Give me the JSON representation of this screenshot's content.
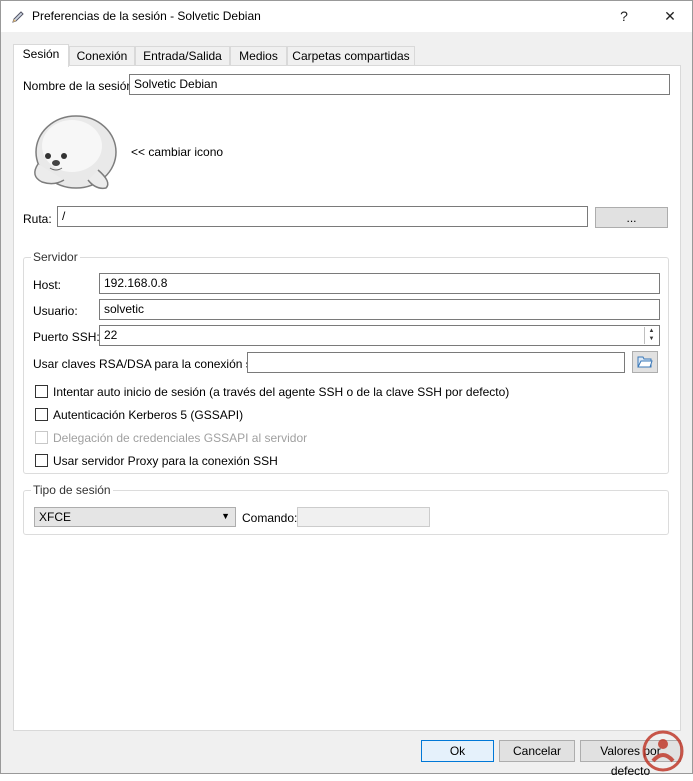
{
  "window": {
    "title": "Preferencias de la sesión - Solvetic Debian",
    "help_label": "?",
    "close_label": "✕"
  },
  "tabs": [
    {
      "label": "Sesión"
    },
    {
      "label": "Conexión"
    },
    {
      "label": "Entrada/Salida"
    },
    {
      "label": "Medios"
    },
    {
      "label": "Carpetas compartidas"
    }
  ],
  "session": {
    "name_label": "Nombre de la sesión:",
    "name_value": "Solvetic Debian",
    "change_icon_label": "<< cambiar icono",
    "path_label": "Ruta:",
    "path_value": "/",
    "browse_label": "..."
  },
  "server": {
    "group_title": "Servidor",
    "host_label": "Host:",
    "host_value": "192.168.0.8",
    "user_label": "Usuario:",
    "user_value": "solvetic",
    "port_label": "Puerto SSH:",
    "port_value": "22",
    "rsa_label": "Usar claves RSA/DSA para la conexión ssh:",
    "rsa_value": "",
    "checkboxes": [
      {
        "label": "Intentar auto inicio de sesión (a través del agente SSH o de la clave SSH por defecto)",
        "checked": false,
        "enabled": true
      },
      {
        "label": "Autenticación Kerberos 5 (GSSAPI)",
        "checked": false,
        "enabled": true
      },
      {
        "label": "Delegación de credenciales GSSAPI al servidor",
        "checked": false,
        "enabled": false
      },
      {
        "label": "Usar servidor Proxy para la conexión SSH",
        "checked": false,
        "enabled": true
      }
    ]
  },
  "session_type": {
    "group_title": "Tipo de sesión",
    "selected": "XFCE",
    "command_label": "Comando:",
    "command_value": ""
  },
  "footer": {
    "ok_label": "Ok",
    "cancel_label": "Cancelar",
    "defaults_label": "Valores por defecto"
  },
  "colors": {
    "accent": "#0078d7",
    "watermark": "#c0392b"
  }
}
